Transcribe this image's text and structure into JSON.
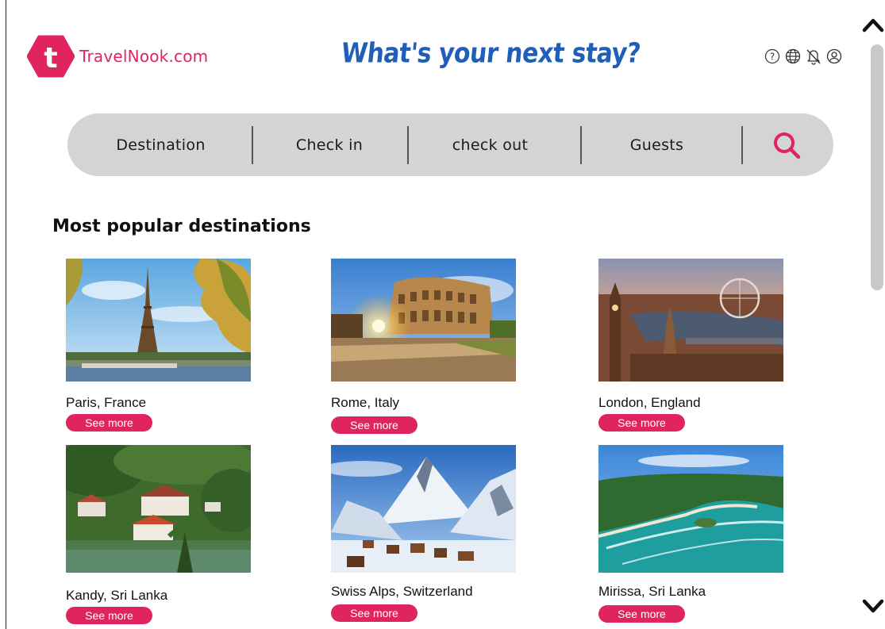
{
  "brand": {
    "name": "TravelNook.com",
    "logo_letter": "t",
    "color": "#e0245e"
  },
  "header": {
    "tagline": "What's your next stay?",
    "icons": [
      "help-icon",
      "globe-icon",
      "notifications-off-icon",
      "account-icon"
    ]
  },
  "search": {
    "destination_label": "Destination",
    "checkin_label": "Check in",
    "checkout_label": "check out",
    "guests_label": "Guests",
    "icon": "search-icon"
  },
  "section": {
    "title": "Most popular destinations"
  },
  "destinations": [
    {
      "name": "Paris, France",
      "button": "See more"
    },
    {
      "name": "Rome, Italy",
      "button": "See more"
    },
    {
      "name": "London, England",
      "button": "See more"
    },
    {
      "name": "Kandy, Sri Lanka",
      "button": "See more"
    },
    {
      "name": "Swiss Alps, Switzerland",
      "button": "See more"
    },
    {
      "name": "Mirissa, Sri Lanka",
      "button": "See more"
    }
  ],
  "colors": {
    "accent": "#e0245e",
    "tagline": "#1f5fb8",
    "searchbar": "#d4d4d4"
  }
}
